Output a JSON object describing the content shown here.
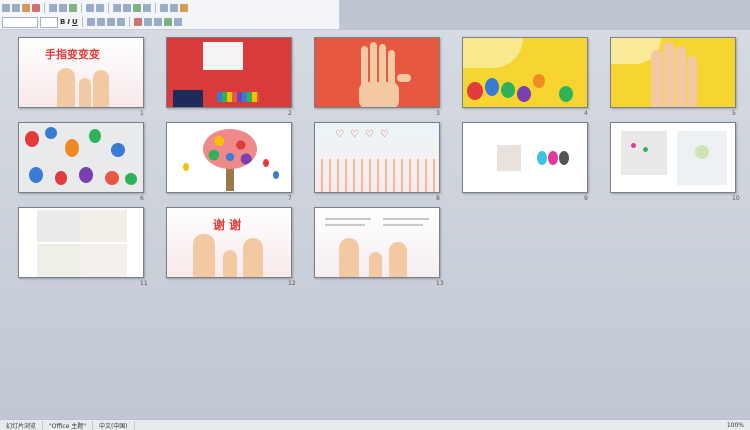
{
  "slides": [
    {
      "num": "1",
      "title": "手指变变变"
    },
    {
      "num": "2"
    },
    {
      "num": "3"
    },
    {
      "num": "4"
    },
    {
      "num": "5"
    },
    {
      "num": "6"
    },
    {
      "num": "7"
    },
    {
      "num": "8"
    },
    {
      "num": "9"
    },
    {
      "num": "10"
    },
    {
      "num": "11"
    },
    {
      "num": "12",
      "title": "谢 谢"
    },
    {
      "num": "13"
    }
  ],
  "status": {
    "slide_info": "幻灯片浏览",
    "theme": "\"Office 主题\"",
    "lang": "中文(中国)",
    "zoom": "100%"
  },
  "colors": {
    "accent": "#e23b3b",
    "yellow": "#f6d531",
    "red_bg": "#e8573f"
  }
}
